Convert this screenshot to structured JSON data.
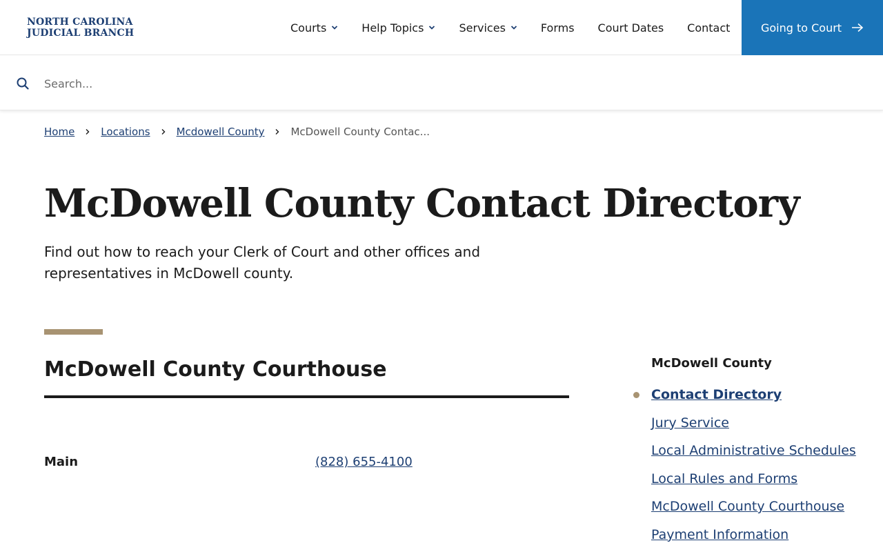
{
  "header": {
    "logo_line1": "NORTH CAROLINA",
    "logo_line2": "JUDICIAL BRANCH",
    "nav": [
      {
        "label": "Courts",
        "has_dropdown": true
      },
      {
        "label": "Help Topics",
        "has_dropdown": true
      },
      {
        "label": "Services",
        "has_dropdown": true
      },
      {
        "label": "Forms",
        "has_dropdown": false
      },
      {
        "label": "Court Dates",
        "has_dropdown": false
      },
      {
        "label": "Contact",
        "has_dropdown": false
      }
    ],
    "cta_label": "Going to Court",
    "cta_color": "#1a74b8"
  },
  "search": {
    "placeholder": "Search...",
    "value": ""
  },
  "breadcrumb": {
    "items": [
      "Home",
      "Locations",
      "Mcdowell County"
    ],
    "current": "McDowell County Contac..."
  },
  "page": {
    "title": "McDowell County Contact Directory",
    "lead": "Find out how to reach your Clerk of Court and other offices and representatives in McDowell county."
  },
  "section": {
    "title": "McDowell County Courthouse",
    "rows": [
      {
        "label": "Main",
        "phone": "(828) 655-4100"
      }
    ]
  },
  "sidebar": {
    "title": "McDowell County",
    "items": [
      {
        "label": "Contact Directory",
        "active": true
      },
      {
        "label": "Jury Service",
        "active": false
      },
      {
        "label": "Local Administrative Schedules",
        "active": false
      },
      {
        "label": "Local Rules and Forms",
        "active": false
      },
      {
        "label": "McDowell County Courthouse",
        "active": false
      },
      {
        "label": "Payment Information",
        "active": false
      }
    ]
  },
  "colors": {
    "brand_navy": "#1d3f73",
    "accent_gold": "#a89372",
    "cta_blue": "#1a74b8"
  }
}
